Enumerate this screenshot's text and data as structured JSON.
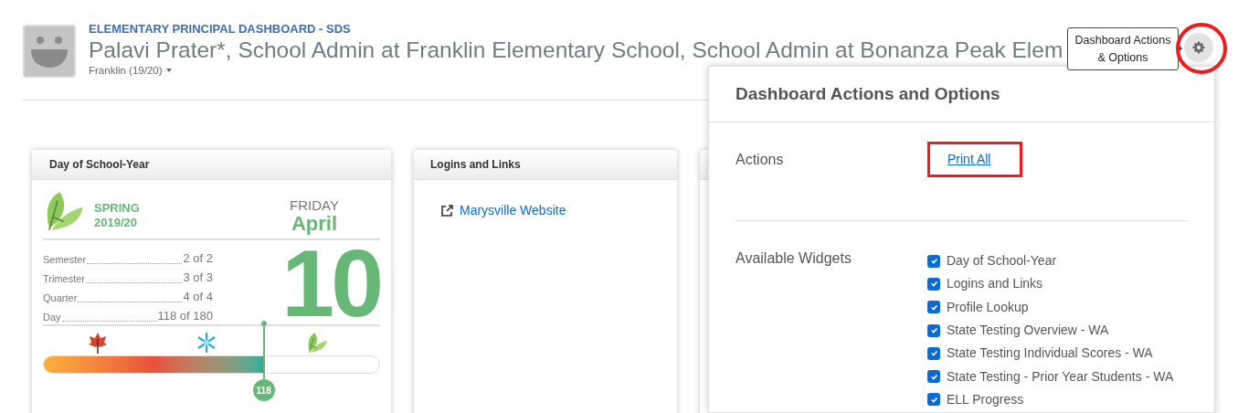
{
  "header": {
    "dashboard_title": "ELEMENTARY PRINCIPAL DASHBOARD - SDS",
    "user_title": "Palavi Prater*, School Admin at Franklin Elementary School, School Admin at Bonanza Peak Elem",
    "school_selector": "Franklin (19/20)"
  },
  "tooltip": "Dashboard Actions & Options",
  "day_widget": {
    "title": "Day of School-Year",
    "season": "SPRING",
    "school_year": "2019/20",
    "weekday": "FRIDAY",
    "month": "April",
    "day": "10",
    "stats": [
      {
        "label": "Semester",
        "value": "2 of 2"
      },
      {
        "label": "Trimester",
        "value": "3 of 3"
      },
      {
        "label": "Quarter",
        "value": "4 of 4"
      },
      {
        "label": "Day",
        "value": "118 of 180"
      }
    ],
    "progress": {
      "level": 0.655,
      "marker": "118"
    }
  },
  "links_widget": {
    "title": "Logins and Links",
    "links": [
      "Marysville Website"
    ]
  },
  "options_panel": {
    "title": "Dashboard Actions and Options",
    "actions_label": "Actions",
    "actions": [
      "Print All"
    ],
    "widgets_label": "Available Widgets",
    "widgets": [
      {
        "label": "Day of School-Year",
        "checked": true
      },
      {
        "label": "Logins and Links",
        "checked": true
      },
      {
        "label": "Profile Lookup",
        "checked": true
      },
      {
        "label": "State Testing Overview - WA",
        "checked": true
      },
      {
        "label": "State Testing Individual Scores - WA",
        "checked": true
      },
      {
        "label": "State Testing - Prior Year Students - WA",
        "checked": true
      },
      {
        "label": "ELL Progress",
        "checked": true
      }
    ]
  }
}
